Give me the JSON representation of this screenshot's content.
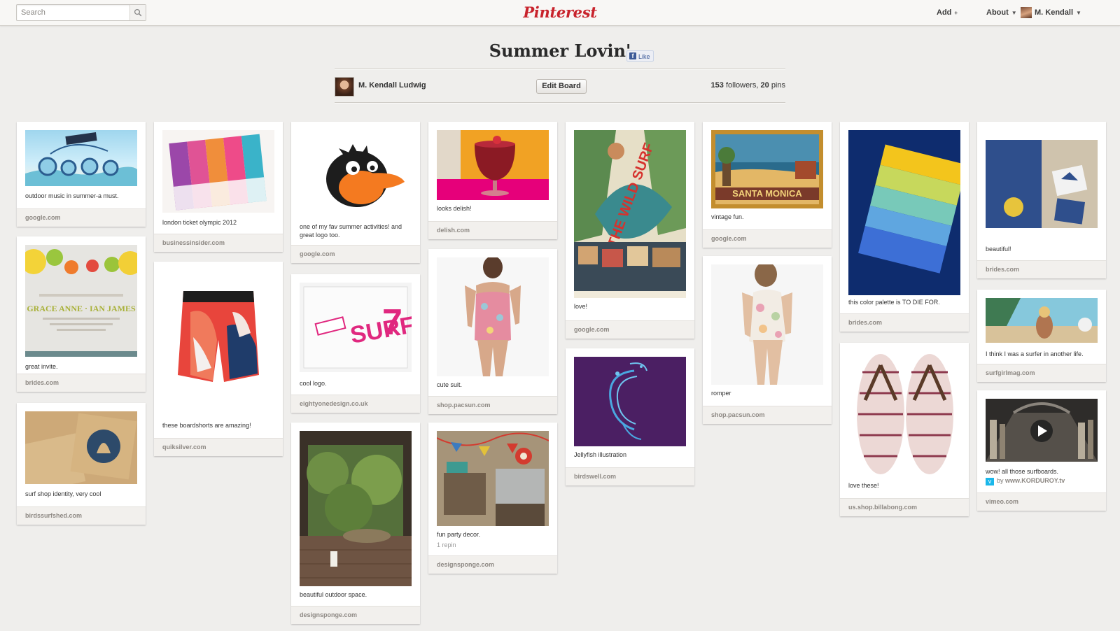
{
  "topbar": {
    "search_placeholder": "Search",
    "logo": "Pinterest",
    "nav": {
      "add": "Add",
      "about": "About",
      "user": "M. Kendall"
    }
  },
  "board": {
    "title": "Summer Lovin'",
    "like_label": "Like",
    "owner": "M. Kendall Ludwig",
    "edit_label": "Edit Board",
    "followers_count": "153",
    "followers_label": "followers,",
    "pins_count": "20",
    "pins_label": "pins"
  },
  "colors": {
    "brand": "#c8232c",
    "background": "#efeeec",
    "source_text": "#8d8883"
  },
  "pins": [
    {
      "desc": "outdoor music in summer-a must.",
      "source": "google.com"
    },
    {
      "desc": "great invite.",
      "source": "brides.com"
    },
    {
      "desc": "surf shop identity, very cool",
      "source": "birdssurfshed.com"
    },
    {
      "desc": "london ticket olympic 2012",
      "source": "businessinsider.com"
    },
    {
      "desc": "these boardshorts are amazing!",
      "source": "quiksilver.com"
    },
    {
      "desc": "one of my fav summer activities! and great logo too.",
      "source": "google.com"
    },
    {
      "desc": "cool logo.",
      "source": "eightyonedesign.co.uk"
    },
    {
      "desc": "beautiful outdoor space.",
      "source": "designsponge.com"
    },
    {
      "desc": "looks delish!",
      "source": "delish.com"
    },
    {
      "desc": "cute suit.",
      "source": "shop.pacsun.com"
    },
    {
      "desc": "fun party decor.",
      "repin": "1 repin",
      "source": "designsponge.com"
    },
    {
      "desc": "love!",
      "source": "google.com"
    },
    {
      "desc": "Jellyfish illustration",
      "source": "birdswell.com"
    },
    {
      "desc": "vintage fun.",
      "source": "google.com"
    },
    {
      "desc": "romper",
      "source": "shop.pacsun.com"
    },
    {
      "desc": "this color palette is TO DIE FOR.",
      "source": "brides.com"
    },
    {
      "desc": "love these!",
      "source": "us.shop.billabong.com"
    },
    {
      "desc": "beautiful!",
      "source": "brides.com"
    },
    {
      "desc": "I think I was a surfer in another life.",
      "source": "surfgirlmag.com"
    },
    {
      "desc": "wow! all those surfboards.",
      "via_prefix": "by",
      "via": "www.KORDUROY.tv",
      "source": "vimeo.com"
    }
  ]
}
